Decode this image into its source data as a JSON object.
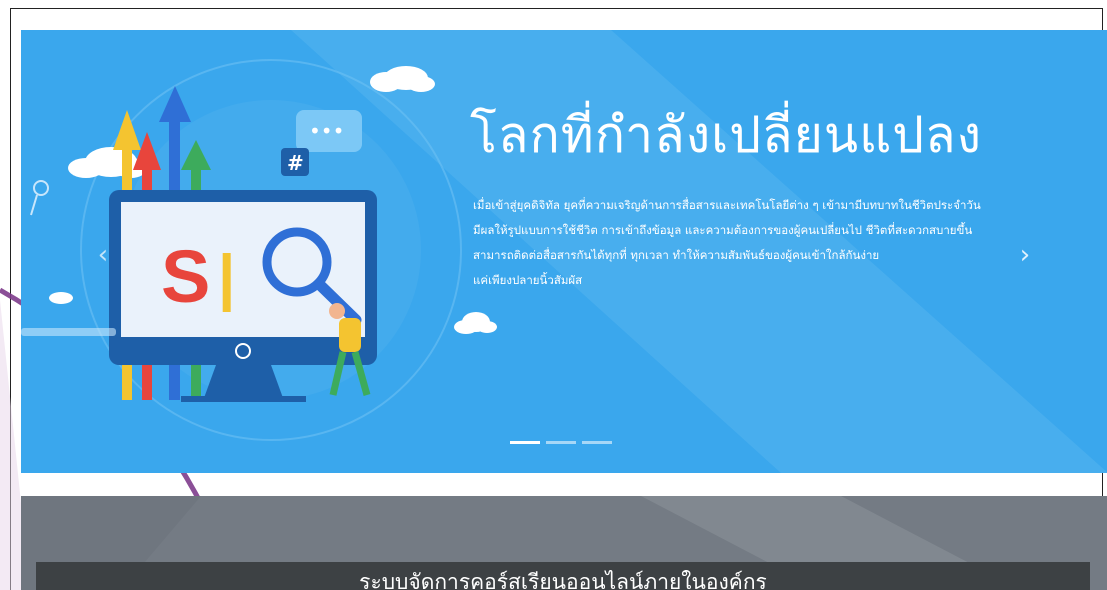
{
  "hero": {
    "title": "โลกที่กำลังเปลี่ยนแปลง",
    "description_lines": [
      "เมื่อเข้าสู่ยุคดิจิทัล ยุคที่ความเจริญด้านการสื่อสารและเทคโนโลยีต่าง ๆ เข้ามามีบทบาทในชีวิตประจำวัน",
      "มีผลให้รูปแบบการใช้ชีวิต การเข้าถึงข้อมูล และความต้องการของผู้คนเปลี่ยนไป ชีวิตที่สะดวกสบายขึ้น",
      "สามารถติดต่อสื่อสารกันได้ทุกที่ ทุกเวลา ทำให้ความสัมพันธ์ของผู้คนเข้าใกล้กันง่าย",
      "แค่เพียงปลายนิ้วสัมผัส"
    ],
    "illustration": {
      "screen_letter_s": "S",
      "screen_letter_bar": "|",
      "hashtag_badge": "#",
      "chat_bubble": "•••"
    },
    "prev_icon": "‹",
    "next_icon": "›",
    "slide_count": 3,
    "active_slide": 1
  },
  "section": {
    "title": "ระบบจัดการคอร์สเรียนออนไลน์ภายในองค์กร"
  },
  "colors": {
    "hero_bg": "#3aa7ed",
    "section_bg": "#747b84",
    "course_bar_bg": "#3d4144",
    "accent_red": "#e8453c",
    "accent_yellow": "#f4c430",
    "accent_green": "#3dab5c",
    "accent_blue": "#2f6fd6"
  }
}
